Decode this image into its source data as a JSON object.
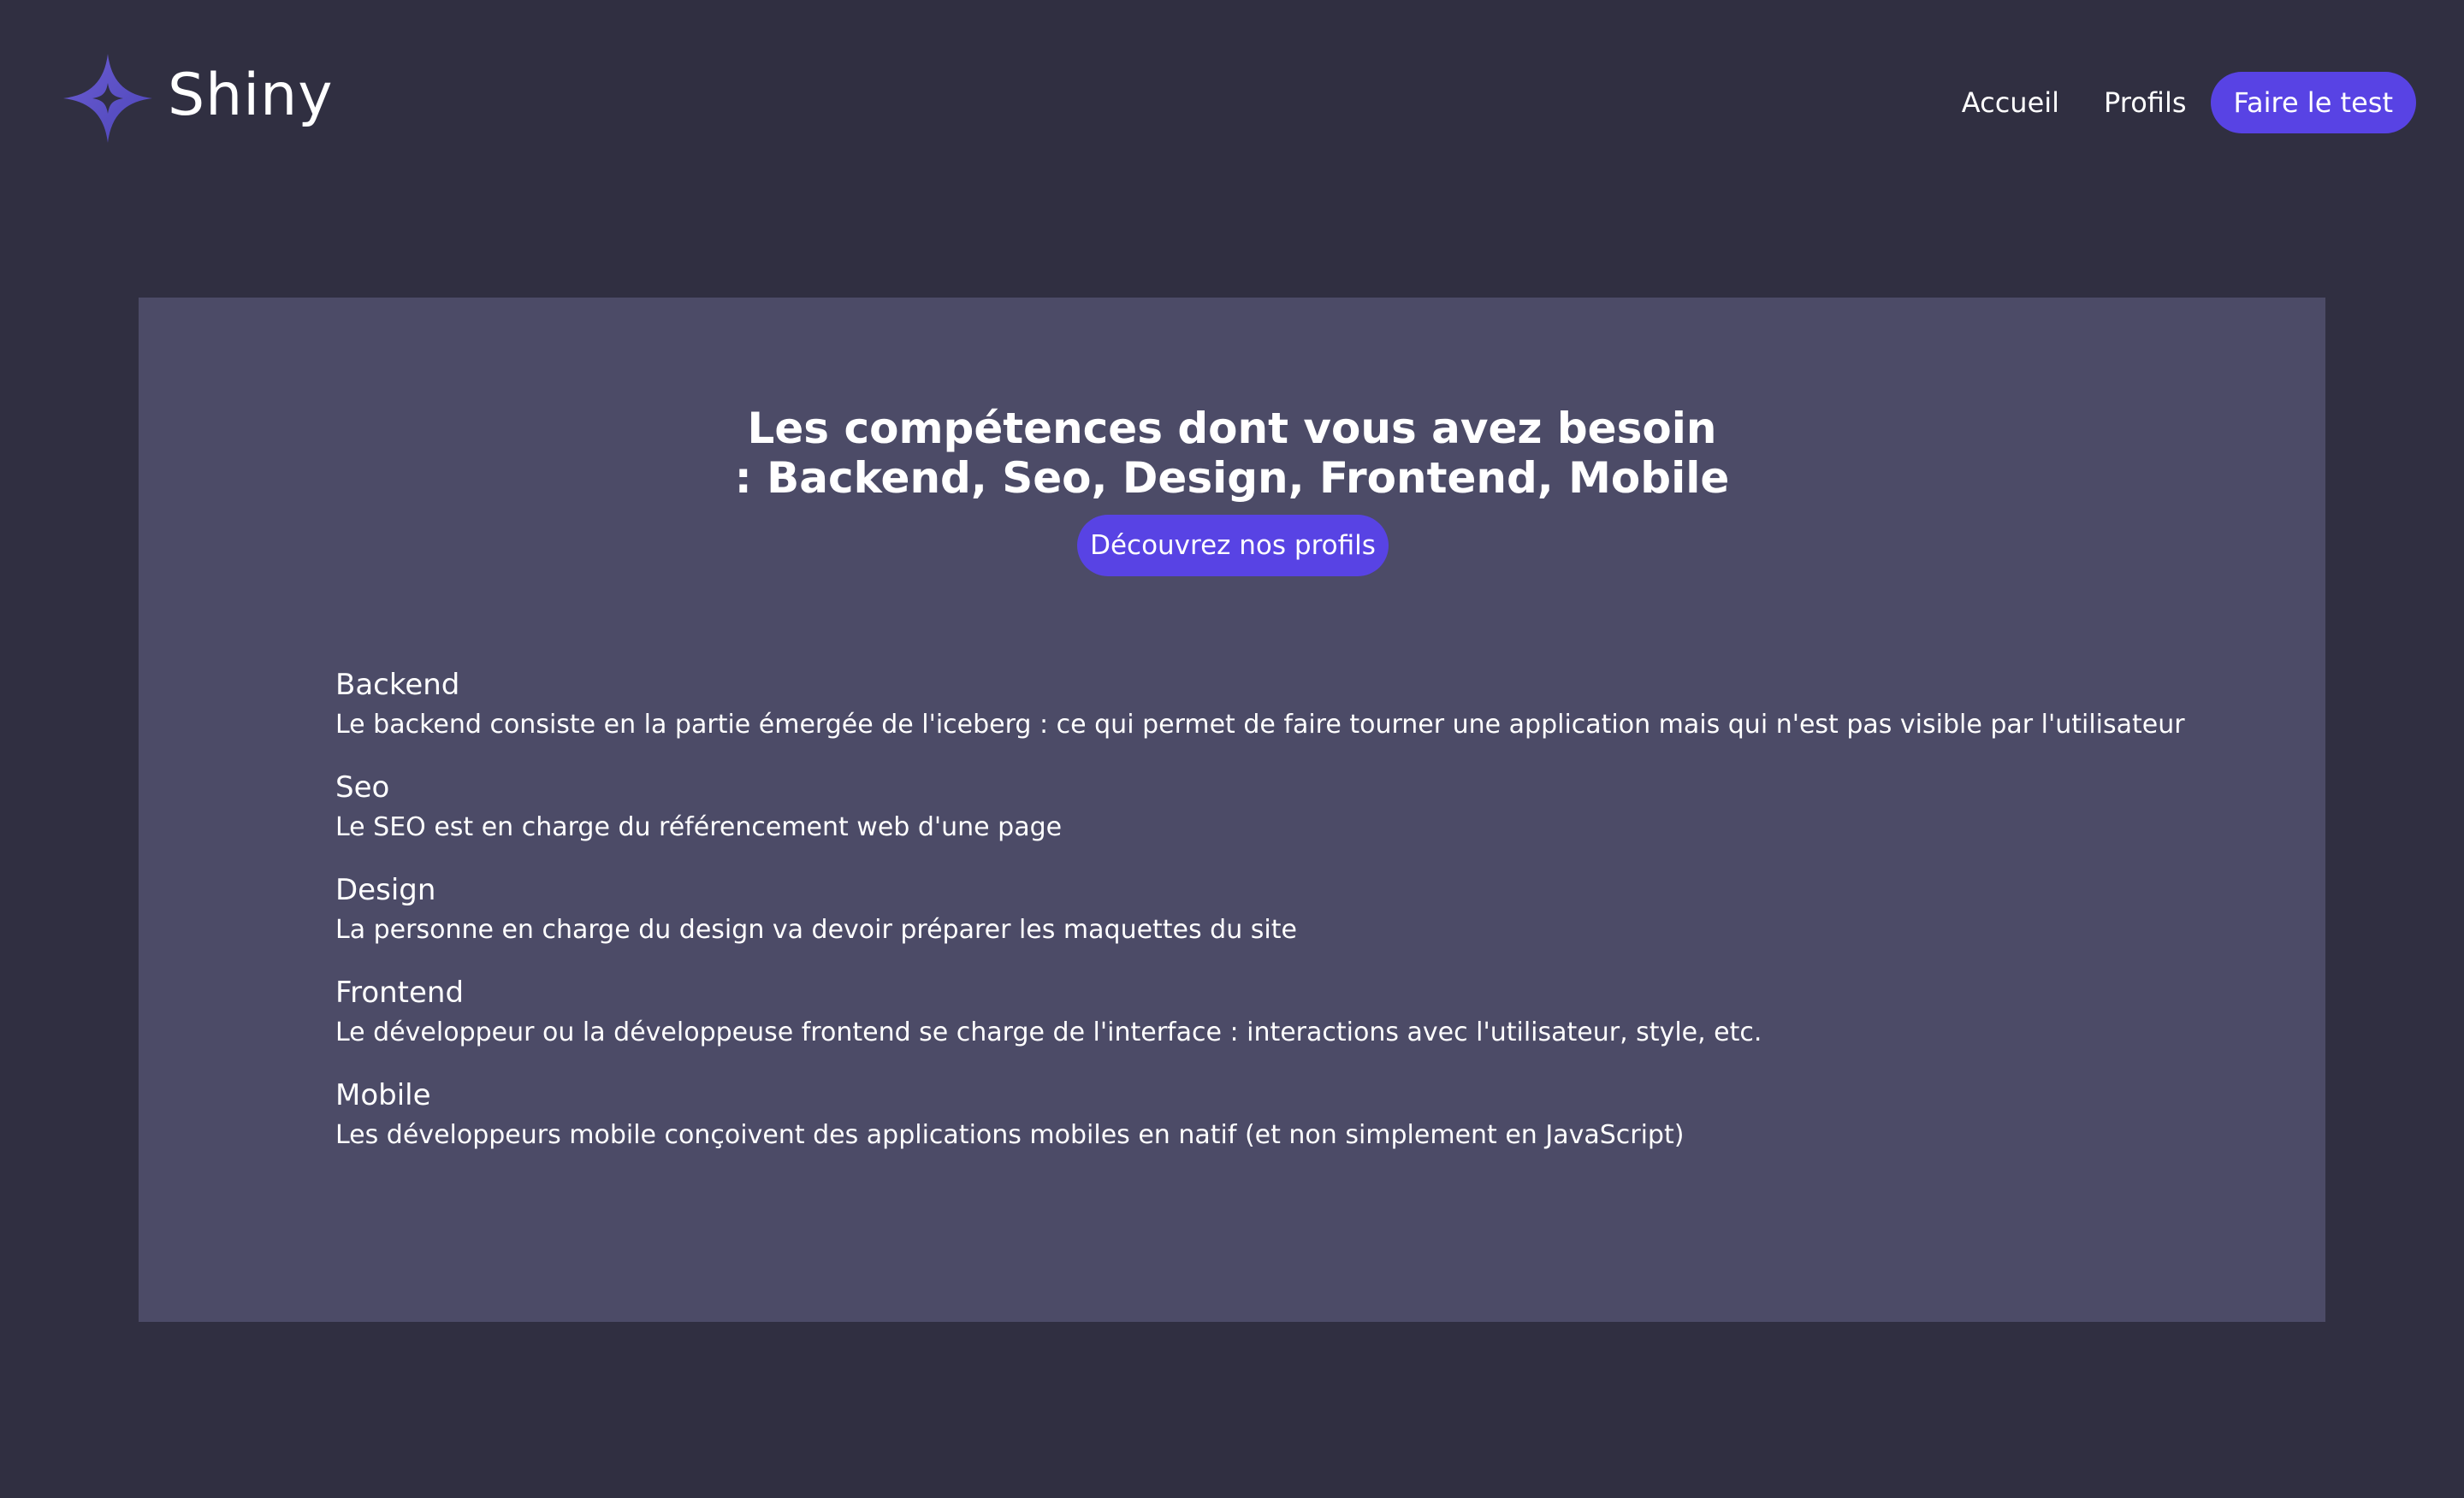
{
  "header": {
    "logo_text": "Shiny",
    "logo_icon": "star-icon",
    "nav": {
      "home": "Accueil",
      "profiles": "Profils",
      "test": "Faire le test"
    }
  },
  "hero": {
    "title_line1": "Les compétences dont vous avez besoin",
    "title_line2": ": Backend, Seo, Design, Frontend, Mobile",
    "cta_label": "Découvrez nos profils"
  },
  "skills": [
    {
      "title": "Backend",
      "description": "Le backend consiste en la partie émergée de l'iceberg : ce qui permet de faire tourner une application mais qui n'est pas visible par l'utilisateur"
    },
    {
      "title": "Seo",
      "description": "Le SEO est en charge du référencement web d'une page"
    },
    {
      "title": "Design",
      "description": "La personne en charge du design va devoir préparer les maquettes du site"
    },
    {
      "title": "Frontend",
      "description": "Le développeur ou la développeuse frontend se charge de l'interface : interactions avec l'utilisateur, style, etc."
    },
    {
      "title": "Mobile",
      "description": "Les développeurs mobile conçoivent des applications mobiles en natif (et non simplement en JavaScript)"
    }
  ],
  "colors": {
    "background": "#302F41",
    "panel": "#4C4B67",
    "accent": "#5843E4",
    "text": "#FFFFFF"
  }
}
